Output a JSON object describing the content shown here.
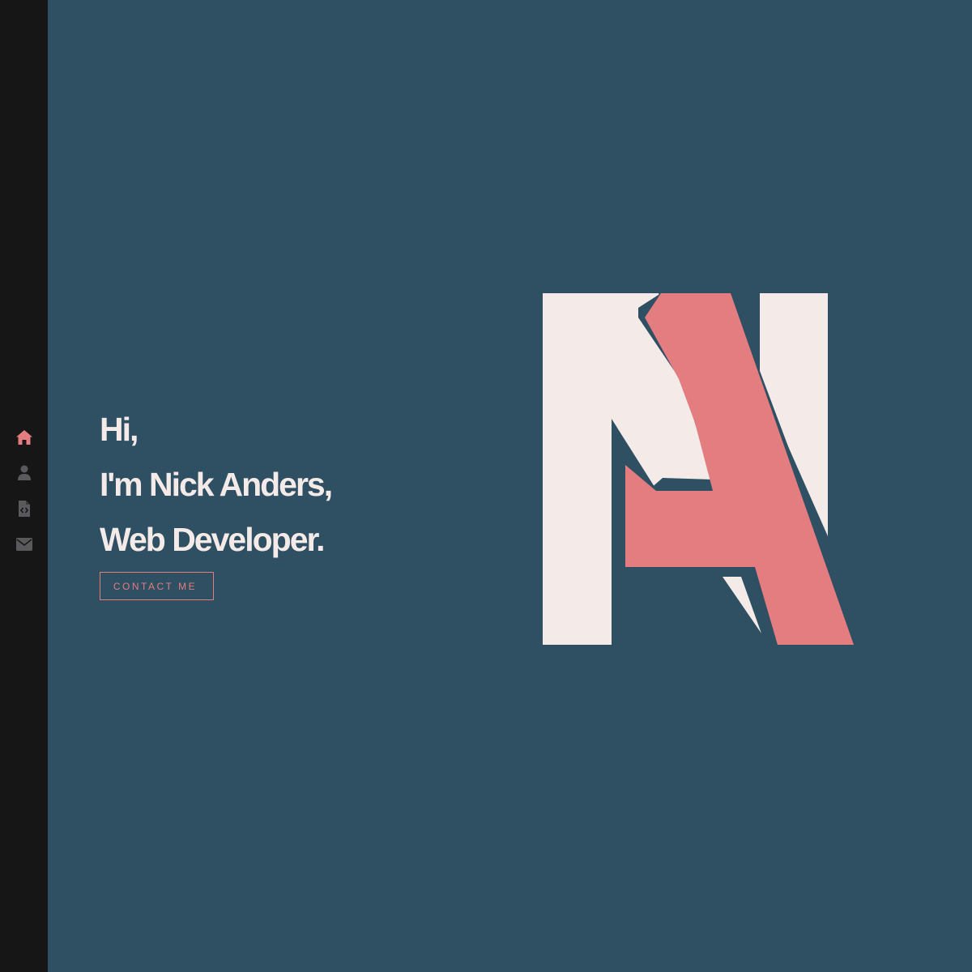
{
  "sidebar": {
    "items": [
      {
        "icon": "home-icon",
        "active": true
      },
      {
        "icon": "user-icon",
        "active": false
      },
      {
        "icon": "file-code-icon",
        "active": false
      },
      {
        "icon": "envelope-icon",
        "active": false
      }
    ]
  },
  "hero": {
    "line1": "Hi,",
    "line2": "I'm Nick Anders,",
    "line3": "Web Developer."
  },
  "cta": {
    "label": "CONTACT ME"
  },
  "logo": {
    "icon": "na-monogram-logo"
  },
  "colors": {
    "background": "#2f4f62",
    "sidebar": "#161617",
    "accent": "#e37d80",
    "text": "#f4ebe9",
    "icon_inactive": "#5a5a5c"
  }
}
